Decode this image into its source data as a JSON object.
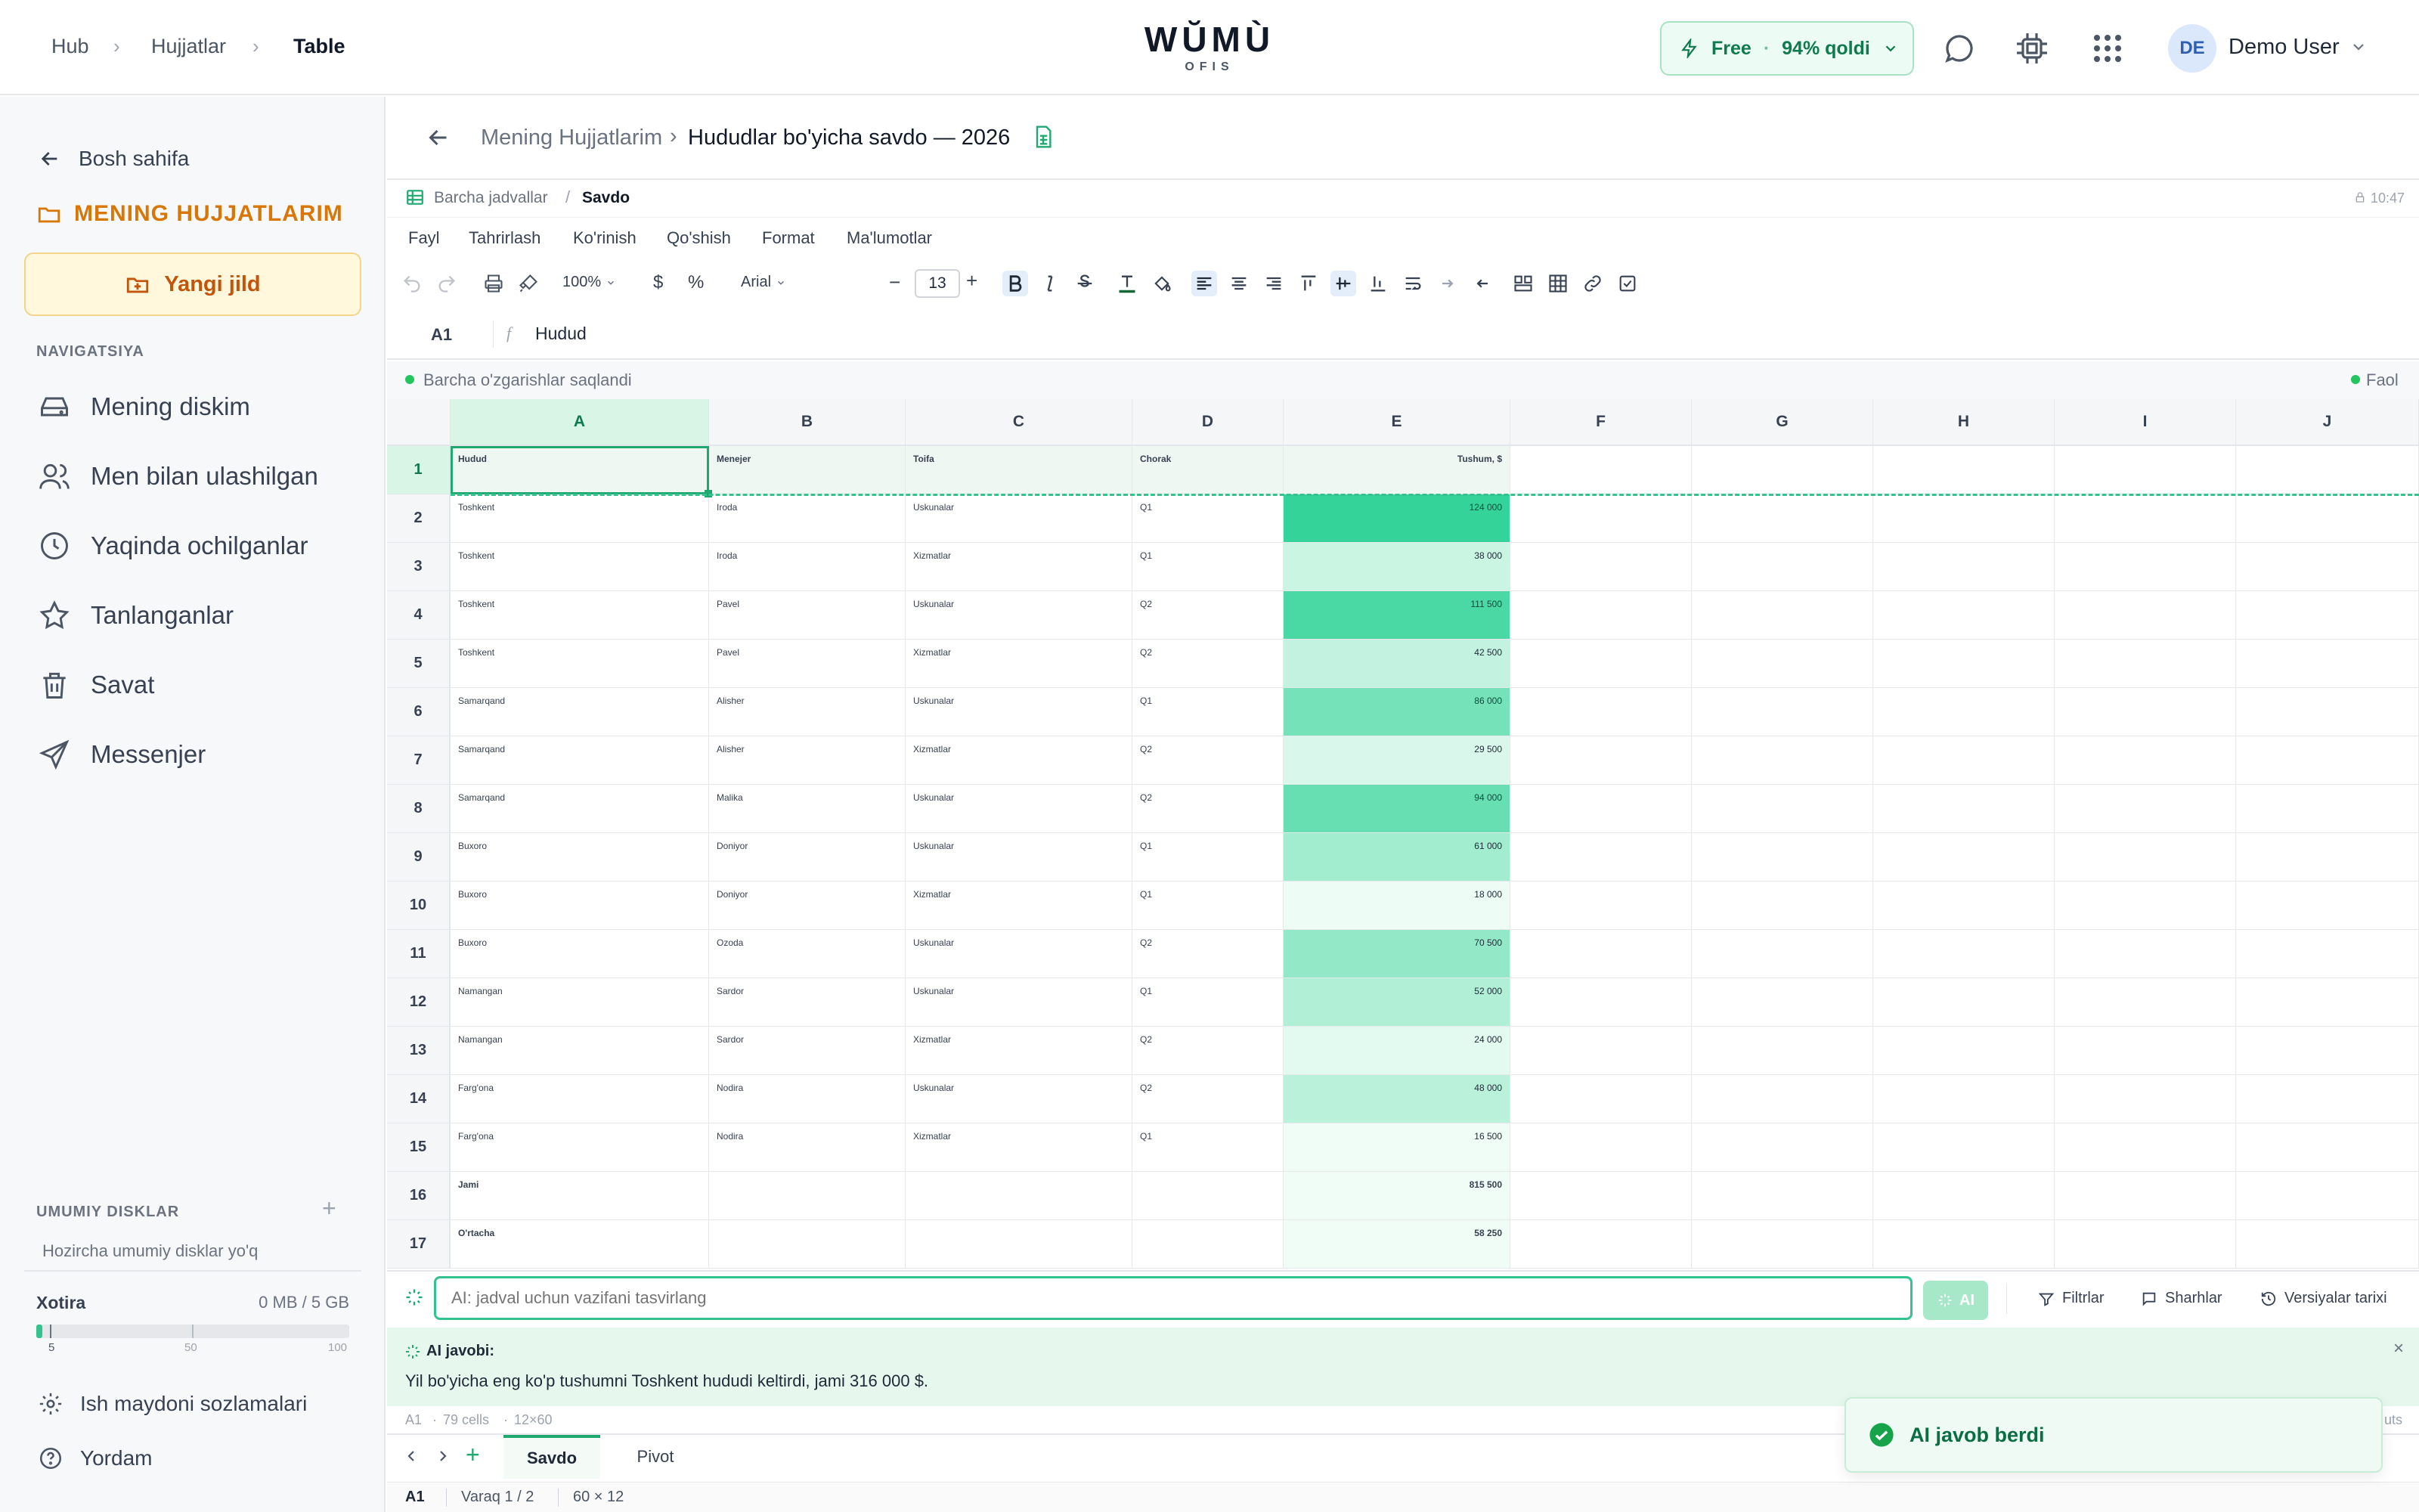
{
  "breadcrumb": {
    "hub": "Hub",
    "docs": "Hujjatlar",
    "current": "Table"
  },
  "logo": {
    "main": "WŬMÙ",
    "sub": "OFIS"
  },
  "plan": {
    "name": "Free",
    "dot": "·",
    "quota": "94% qoldi"
  },
  "user": {
    "initials": "DE",
    "name": "Demo User"
  },
  "sidebar": {
    "back": "Bosh sahifa",
    "section_title": "MENING HUJJATLARIM",
    "new_folder": "Yangi jild",
    "nav_title": "NAVIGATSIYA",
    "items": [
      {
        "label": "Mening diskim",
        "icon": "drive-icon"
      },
      {
        "label": "Men bilan ulashilgan",
        "icon": "users-icon"
      },
      {
        "label": "Yaqinda ochilganlar",
        "icon": "clock-icon"
      },
      {
        "label": "Tanlanganlar",
        "icon": "star-icon"
      },
      {
        "label": "Savat",
        "icon": "trash-icon"
      },
      {
        "label": "Messenjer",
        "icon": "send-icon"
      }
    ],
    "shared_title": "UMUMIY DISKLAR",
    "shared_empty": "Hozircha umumiy disklar yo'q",
    "storage_label": "Xotira",
    "storage_value": "0 MB / 5 GB",
    "storage_ticks": [
      "5",
      "50",
      "100"
    ],
    "storage_used_fraction": 0.02,
    "settings": "Ish maydoni sozlamalari",
    "help": "Yordam"
  },
  "doc": {
    "parent": "Mening Hujjatlarim",
    "sep": "›",
    "title": "Hududlar bo'yicha savdo — 2026",
    "all_sheets": "Barcha jadvallar",
    "slash": "/",
    "sheet": "Savdo",
    "time": "10:47"
  },
  "menu": [
    "Fayl",
    "Tahrirlash",
    "Ko'rinish",
    "Qo'shish",
    "Format",
    "Ma'lumotlar"
  ],
  "toolbar": {
    "zoom": "100%",
    "currency": "$",
    "percent": "%",
    "font": "Arial",
    "font_size": "13"
  },
  "formula": {
    "cell_ref": "A1",
    "fx": "f",
    "value": "Hudud"
  },
  "status": {
    "saved": "Barcha o'zgarishlar saqlandi",
    "active": "Faol"
  },
  "grid": {
    "columns": [
      "A",
      "B",
      "C",
      "D",
      "E",
      "F",
      "G",
      "H",
      "I",
      "J"
    ],
    "header_row": [
      "Hudud",
      "Menejer",
      "Toifa",
      "Chorak",
      "Tushum, $"
    ],
    "rows": [
      [
        "Toshkent",
        "Iroda",
        "Uskunalar",
        "Q1",
        "124 000"
      ],
      [
        "Toshkent",
        "Iroda",
        "Xizmatlar",
        "Q1",
        "38 000"
      ],
      [
        "Toshkent",
        "Pavel",
        "Uskunalar",
        "Q2",
        "111 500"
      ],
      [
        "Toshkent",
        "Pavel",
        "Xizmatlar",
        "Q2",
        "42 500"
      ],
      [
        "Samarqand",
        "Alisher",
        "Uskunalar",
        "Q1",
        "86 000"
      ],
      [
        "Samarqand",
        "Alisher",
        "Xizmatlar",
        "Q2",
        "29 500"
      ],
      [
        "Samarqand",
        "Malika",
        "Uskunalar",
        "Q2",
        "94 000"
      ],
      [
        "Buxoro",
        "Doniyor",
        "Uskunalar",
        "Q1",
        "61 000"
      ],
      [
        "Buxoro",
        "Doniyor",
        "Xizmatlar",
        "Q1",
        "18 000"
      ],
      [
        "Buxoro",
        "Ozoda",
        "Uskunalar",
        "Q2",
        "70 500"
      ],
      [
        "Namangan",
        "Sardor",
        "Uskunalar",
        "Q1",
        "52 000"
      ],
      [
        "Namangan",
        "Sardor",
        "Xizmatlar",
        "Q2",
        "24 000"
      ],
      [
        "Farg'ona",
        "Nodira",
        "Uskunalar",
        "Q2",
        "48 000"
      ],
      [
        "Farg'ona",
        "Nodira",
        "Xizmatlar",
        "Q1",
        "16 500"
      ]
    ],
    "totals": [
      [
        "Jami",
        "",
        "",
        "",
        "815 500"
      ],
      [
        "O'rtacha",
        "",
        "",
        "",
        "58 250"
      ]
    ],
    "row_numbers": [
      "1",
      "2",
      "3",
      "4",
      "5",
      "6",
      "7",
      "8",
      "9",
      "10",
      "11",
      "12",
      "13",
      "14",
      "15",
      "16",
      "17"
    ]
  },
  "ai": {
    "placeholder": "AI: jadval uchun vazifani tasvirlang",
    "button": "AI",
    "filters": "Filtrlar",
    "comments": "Sharhlar",
    "history": "Versiyalar tarixi",
    "answer_title": "AI javobi:",
    "answer_text": "Yil bo'yicha eng ko'p tushumni Toshkent hududi keltirdi, jami 316 000 $.",
    "toast": "AI javob berdi"
  },
  "statusbar": {
    "ref": "A1",
    "dot": "·",
    "cells": "79 cells",
    "size": "12×60",
    "hint": "uts"
  },
  "sheettabs": {
    "tabs": [
      "Savdo",
      "Pivot"
    ],
    "add": "+"
  },
  "footer": {
    "ref": "A1",
    "page": "Varaq 1 / 2",
    "dims": "60 × 12"
  },
  "colors": {
    "accent": "#1fa971",
    "heat_high": "#34d399",
    "heat_low": "#ecfdf5",
    "orange": "#d97706"
  }
}
